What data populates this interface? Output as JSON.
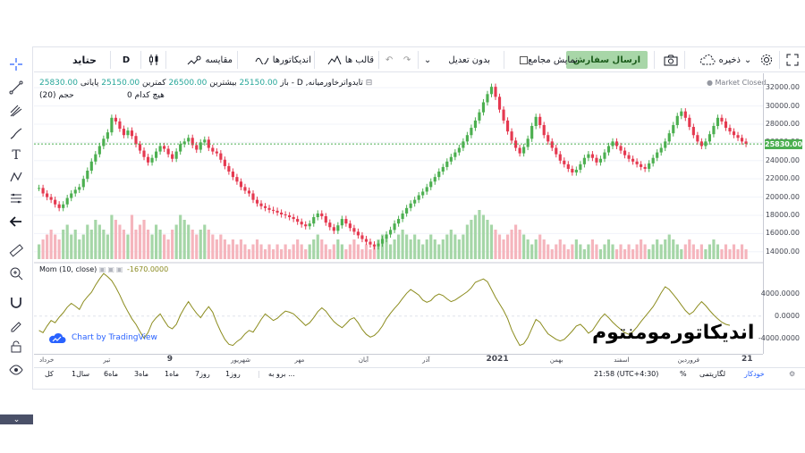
{
  "toolbar": {
    "symbol": "حتاید",
    "interval": "D",
    "compare": "مقایسه",
    "indicators": "اندیکاتورها",
    "templates": "قالب ها",
    "adjust": "بدون تعدیل",
    "show_aggregate": "نمایش مجامع",
    "send_order": "ارسال سفارش",
    "save": "ذخیره"
  },
  "legend": {
    "symbol_title": "تایدواترخاورمیانه, D -",
    "open_label": "باز",
    "open_value": "25150.00",
    "high_label": "بیشترین",
    "high_value": "26500.00",
    "low_label": "کمترین",
    "low_value": "25150.00",
    "close_label": "پایانی",
    "close_value": "25830.00",
    "none_label": "هیچ کدام",
    "none_value": "0",
    "volume_label": "حجم (20)",
    "market_status": "Market Closed",
    "mom_label": "Mom (10, close)",
    "mom_value": "-1670.0000"
  },
  "price_axis": {
    "labels": [
      "32000.00",
      "30000.00",
      "28000.00",
      "26000.00",
      "24000.00",
      "22000.00",
      "20000.00",
      "18000.00",
      "16000.00",
      "14000.00"
    ],
    "last_price": "25830.00",
    "mom_labels": [
      "4000.0000",
      "0.0000",
      "-4000.0000"
    ]
  },
  "time_axis": {
    "labels": [
      {
        "text": "خرداد",
        "strong": false
      },
      {
        "text": "تیر",
        "strong": false
      },
      {
        "text": "9",
        "strong": true
      },
      {
        "text": "شهریور",
        "strong": false
      },
      {
        "text": "مهر",
        "strong": false
      },
      {
        "text": "آبان",
        "strong": false
      },
      {
        "text": "آذر",
        "strong": false
      },
      {
        "text": "2021",
        "strong": true
      },
      {
        "text": "بهمن",
        "strong": false
      },
      {
        "text": "اسفند",
        "strong": false
      },
      {
        "text": "فروردین",
        "strong": false
      },
      {
        "text": "21",
        "strong": true
      }
    ]
  },
  "bottom_bar": {
    "ranges": [
      "کل",
      "1سال",
      "6ماه",
      "3ماه",
      "1ماه",
      "7روز",
      "1روز"
    ],
    "goto": "برو به ...",
    "time": "21:58 (UTC+4:30)",
    "percent": "%",
    "log": "لگاریتمی",
    "auto": "خودکار"
  },
  "watermark": {
    "brand": "اندیکاتورمومنتوم",
    "tv": "Chart by TradingView"
  },
  "colors": {
    "up": "#4caf50",
    "down": "#e53950",
    "up_vol": "#a5d6a7",
    "down_vol": "#f5b5bd",
    "mom_line": "#8c8c1e",
    "last_price_line": "#4caf50"
  },
  "chart_data": {
    "type": "candlestick",
    "price_ylim": [
      13000,
      32800
    ],
    "closes": [
      21000,
      20400,
      20000,
      19700,
      19200,
      18800,
      19200,
      19900,
      20400,
      20800,
      21100,
      22000,
      22900,
      23900,
      24700,
      25600,
      26400,
      27100,
      28700,
      28300,
      27500,
      26800,
      27300,
      26700,
      25800,
      25100,
      24400,
      23800,
      24300,
      25000,
      25600,
      25300,
      24700,
      24200,
      25000,
      25800,
      26100,
      26500,
      25700,
      25200,
      26000,
      26300,
      25400,
      25000,
      24800,
      24100,
      23400,
      22800,
      22200,
      21700,
      21100,
      20700,
      20400,
      19700,
      19300,
      19000,
      18800,
      18600,
      18500,
      18300,
      18100,
      18000,
      17800,
      17600,
      17300,
      17000,
      16800,
      17100,
      17800,
      18200,
      17900,
      17200,
      16700,
      16300,
      16900,
      17600,
      17100,
      16600,
      16200,
      15800,
      15400,
      15100,
      14800,
      14600,
      14900,
      15400,
      15900,
      16400,
      17100,
      17600,
      18200,
      18800,
      19300,
      19700,
      20200,
      20600,
      21100,
      21700,
      22200,
      22800,
      23300,
      23900,
      24400,
      24900,
      25400,
      26100,
      26800,
      27600,
      28400,
      29300,
      30400,
      31300,
      32100,
      31000,
      29600,
      28400,
      27200,
      26200,
      25400,
      24800,
      25500,
      26400,
      27800,
      28800,
      27900,
      26800,
      26100,
      25400,
      24700,
      24000,
      23600,
      23100,
      22700,
      23000,
      23600,
      24300,
      24700,
      24300,
      23800,
      24200,
      24900,
      25600,
      26100,
      25600,
      25100,
      24600,
      24200,
      23900,
      23600,
      23300,
      23100,
      23700,
      24300,
      24900,
      25400,
      26100,
      27000,
      27900,
      28900,
      29400,
      28700,
      27700,
      26800,
      26100,
      25600,
      26100,
      26900,
      27800,
      28700,
      28300,
      27600,
      27200,
      26800,
      26500,
      26100,
      25830
    ],
    "volumes": [
      3,
      4,
      5,
      6,
      5,
      4,
      6,
      7,
      5,
      6,
      4,
      5,
      7,
      6,
      8,
      7,
      6,
      5,
      9,
      8,
      7,
      6,
      5,
      9,
      6,
      7,
      8,
      6,
      5,
      7,
      6,
      5,
      4,
      6,
      7,
      9,
      8,
      7,
      6,
      5,
      6,
      7,
      6,
      5,
      4,
      5,
      4,
      3,
      4,
      3,
      4,
      3,
      2,
      3,
      4,
      3,
      2,
      3,
      2,
      3,
      2,
      3,
      2,
      3,
      4,
      3,
      2,
      3,
      4,
      5,
      4,
      3,
      2,
      3,
      4,
      3,
      2,
      3,
      4,
      3,
      2,
      3,
      2,
      3,
      4,
      5,
      4,
      3,
      4,
      5,
      6,
      5,
      4,
      5,
      4,
      3,
      4,
      5,
      4,
      3,
      4,
      5,
      6,
      5,
      4,
      5,
      7,
      8,
      9,
      10,
      9,
      8,
      7,
      6,
      5,
      4,
      5,
      6,
      7,
      6,
      5,
      4,
      3,
      4,
      5,
      4,
      3,
      2,
      3,
      4,
      3,
      2,
      3,
      4,
      3,
      2,
      3,
      4,
      3,
      2,
      3,
      4,
      3,
      2,
      3,
      2,
      3,
      2,
      3,
      4,
      3,
      2,
      3,
      4,
      3,
      4,
      5,
      4,
      3,
      2,
      3,
      4,
      3,
      2,
      3,
      2,
      3,
      4,
      3,
      2,
      3,
      2,
      3,
      2,
      3,
      2
    ],
    "mom": [
      -2600,
      -3000,
      -1800,
      -800,
      -1200,
      -200,
      600,
      1600,
      2300,
      1800,
      1200,
      2600,
      3500,
      4300,
      5600,
      6700,
      7700,
      7100,
      6400,
      5200,
      3800,
      2200,
      800,
      -500,
      -1500,
      -2800,
      -4000,
      -3000,
      -1200,
      -300,
      400,
      -800,
      -1900,
      -2300,
      -1500,
      200,
      1500,
      2600,
      1500,
      500,
      -300,
      800,
      1700,
      700,
      -1200,
      -2800,
      -4200,
      -5100,
      -5300,
      -4600,
      -4100,
      -3200,
      -2600,
      -2900,
      -1800,
      -600,
      400,
      -200,
      -800,
      -400,
      300,
      900,
      700,
      400,
      -300,
      -1000,
      -1700,
      -1200,
      -300,
      800,
      1500,
      900,
      -100,
      -1000,
      -1600,
      -2100,
      -1400,
      -600,
      -300,
      -1200,
      -2400,
      -3300,
      -3800,
      -3500,
      -2800,
      -1800,
      -500,
      500,
      1400,
      2200,
      3200,
      4100,
      4800,
      4300,
      3800,
      2900,
      2500,
      2800,
      3600,
      4000,
      3700,
      3100,
      2600,
      2900,
      3400,
      3900,
      4400,
      5100,
      6100,
      6400,
      6700,
      6200,
      4800,
      3400,
      2200,
      1000,
      -500,
      -2500,
      -4000,
      -5300,
      -5000,
      -3900,
      -2200,
      -600,
      -1100,
      -2200,
      -3200,
      -3700,
      -4200,
      -4500,
      -4200,
      -3500,
      -2700,
      -1800,
      -1500,
      -2200,
      -3100,
      -2600,
      -1500,
      -400,
      400,
      -300,
      -1100,
      -1800,
      -2400,
      -3000,
      -3300,
      -2800,
      -2000,
      -1000,
      -100,
      800,
      1700,
      2900,
      4200,
      5300,
      4800,
      3900,
      3000,
      2000,
      1000,
      300,
      800,
      1800,
      2600,
      1900,
      1000,
      200,
      -500,
      -1100,
      -1500,
      -1670
    ],
    "mom_ylim": [
      -6500,
      9000
    ]
  }
}
